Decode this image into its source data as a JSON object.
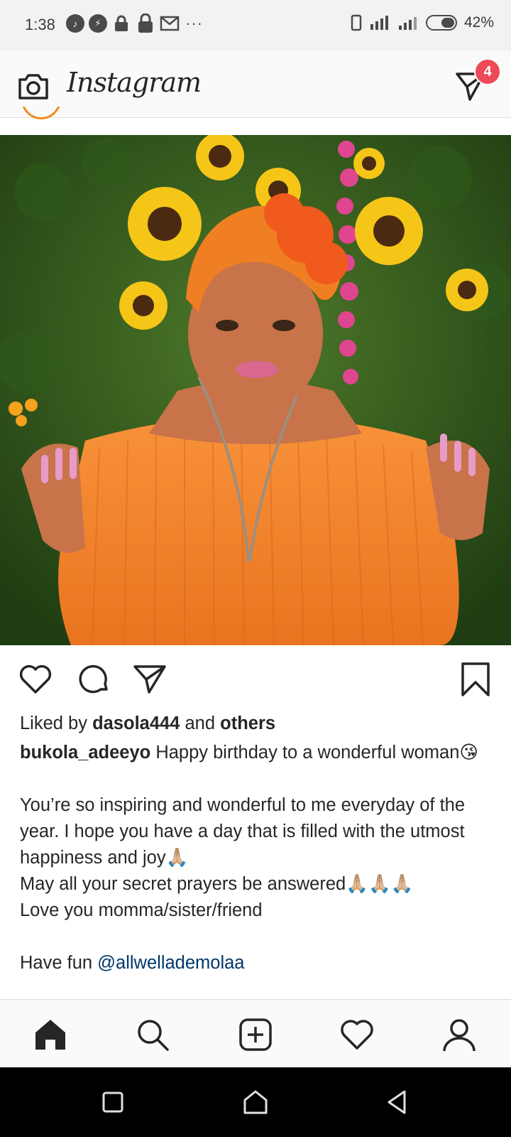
{
  "status_bar": {
    "time": "1:38",
    "battery_percent": "42%",
    "left_icons": [
      "tiktok-icon",
      "messenger-icon",
      "lock-icon",
      "lock-icon",
      "mail-icon"
    ],
    "more": "···"
  },
  "header": {
    "logo_text": "Instagram",
    "direct_badge_count": "4"
  },
  "post": {
    "photo_description_icon": "post-photo",
    "liked_by_prefix": "Liked by ",
    "liked_by_user": "dasola444",
    "liked_by_mid": " and ",
    "liked_by_others": "others",
    "caption_author": "bukola_adeeyo",
    "caption_line1": " Happy birthday to a wonderful woman😘",
    "caption_body": "You’re so inspiring and wonderful to me everyday of the year. I hope you have a day that is filled with the utmost happiness and joy🙏🏼\nMay all your secret prayers be answered🙏🏼🙏🏼🙏🏼\nLove you momma/sister/friend",
    "caption_fun_prefix": "Have fun ",
    "caption_mention": "@allwellademolaa"
  },
  "colors": {
    "accent_badge": "#ed4956",
    "link": "#00376b",
    "text": "#262626"
  }
}
